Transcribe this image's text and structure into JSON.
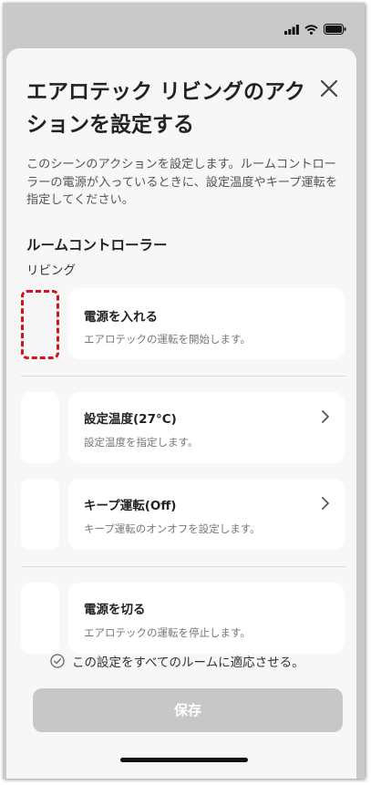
{
  "sheet": {
    "title": "エアロテック リビングのアクションを設定する",
    "description": "このシーンのアクションを設定します。ルームコントローラーの電源が入っているときに、設定温度やキープ運転を指定してください。"
  },
  "controller": {
    "heading": "ルームコントローラー",
    "room": "リビング"
  },
  "actions": [
    {
      "title": "電源を入れる",
      "subtitle": "エアロテックの運転を開始します。"
    },
    {
      "title": "設定温度(27°C)",
      "subtitle": "設定温度を指定します。"
    },
    {
      "title": "キープ運転(Off)",
      "subtitle": "キープ運転のオンオフを設定します。"
    },
    {
      "title": "電源を切る",
      "subtitle": "エアロテックの運転を停止します。"
    }
  ],
  "apply_all": {
    "label": "この設定をすべてのルームに適応させる。"
  },
  "save": {
    "label": "保存"
  },
  "colors": {
    "highlight": "#d0161d",
    "disabled_button": "#c7c7c7"
  },
  "icons": [
    "cellular-signal-icon",
    "wifi-icon",
    "battery-icon",
    "close-icon",
    "chevron-right-icon",
    "check-circle-icon"
  ]
}
